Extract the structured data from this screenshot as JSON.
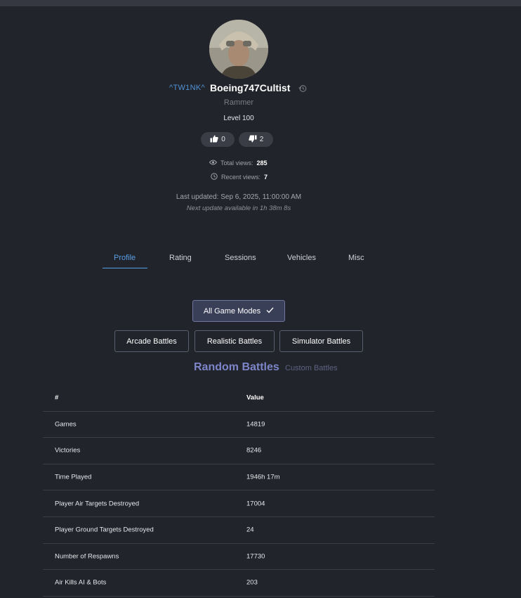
{
  "profile": {
    "clan_tag": "^TW1NK^",
    "username": "Boeing747Cultist",
    "title": "Rammer",
    "level": "Level 100",
    "likes": "0",
    "dislikes": "2"
  },
  "views": {
    "total_label": "Total views:",
    "total_value": "285",
    "recent_label": "Recent views:",
    "recent_value": "7"
  },
  "update": {
    "last_updated": "Last updated: Sep 6, 2025, 11:00:00 AM",
    "next_update": "Next update available in 1h 38m 8s"
  },
  "tabs": [
    {
      "label": "Profile",
      "active": true
    },
    {
      "label": "Rating",
      "active": false
    },
    {
      "label": "Sessions",
      "active": false
    },
    {
      "label": "Vehicles",
      "active": false
    },
    {
      "label": "Misc",
      "active": false
    }
  ],
  "mode_filters": {
    "all": "All Game Modes",
    "arcade": "Arcade Battles",
    "realistic": "Realistic Battles",
    "simulator": "Simulator Battles"
  },
  "battle_type": {
    "random": "Random Battles",
    "custom": "Custom Battles"
  },
  "table": {
    "headers": [
      "#",
      "Value"
    ],
    "rows": [
      [
        "Games",
        "14819"
      ],
      [
        "Victories",
        "8246"
      ],
      [
        "Time Played",
        "1946h 17m"
      ],
      [
        "Player Air Targets Destroyed",
        "17004"
      ],
      [
        "Player Ground Targets Destroyed",
        "24"
      ],
      [
        "Number of Respawns",
        "17730"
      ],
      [
        "Air Kills AI & Bots",
        "203"
      ]
    ]
  },
  "colors": {
    "background": "#22242b",
    "accent_blue": "#5a9fe6",
    "random_battles": "#7d85c9",
    "custom_battles": "#5c6282"
  },
  "icons": {
    "history": "history-icon",
    "like": "thumbs-up-icon",
    "dislike": "thumbs-down-icon",
    "eye": "eye-icon",
    "clock": "clock-icon",
    "check": "check-icon"
  }
}
